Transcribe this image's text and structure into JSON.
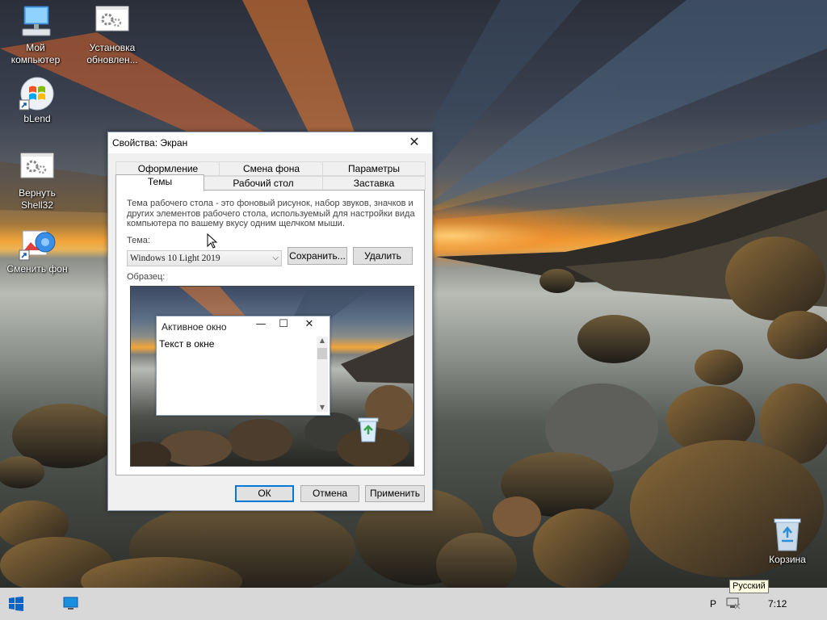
{
  "desktop": {
    "icons": [
      {
        "label": "Мой\nкомпьютер",
        "icon": "computer-icon"
      },
      {
        "label": "Установка\nобновлен...",
        "icon": "gear-icon"
      },
      {
        "label": "bLend",
        "icon": "windows-logo-icon"
      },
      {
        "label": "Вернуть\nShell32",
        "icon": "gear-icon"
      },
      {
        "label": "Сменить фон",
        "icon": "change-wallpaper-icon"
      },
      {
        "label": "Корзина",
        "icon": "recycle-bin-icon"
      }
    ]
  },
  "dialog": {
    "title": "Свойства: Экран",
    "tabs_row1": [
      "Оформление",
      "Смена фона",
      "Параметры"
    ],
    "tabs_row2": [
      "Темы",
      "Рабочий стол",
      "Заставка"
    ],
    "active_tab": "Темы",
    "description": "Тема рабочего стола - это фоновый рисунок, набор звуков, значков и других элементов рабочего стола, используемый для настройки вида компьютера по вашему вкусу одним щелчком мыши.",
    "theme_label": "Тема:",
    "theme_value": "Windows 10 Light 2019",
    "save_label": "Сохранить...",
    "delete_label": "Удалить",
    "sample_label": "Образец:",
    "preview_window": {
      "title": "Активное окно",
      "text": "Текст в окне"
    },
    "ok_label": "ОК",
    "cancel_label": "Отмена",
    "apply_label": "Применить"
  },
  "taskbar": {
    "lang_short": "Р",
    "lang_tooltip": "Русский",
    "clock": "7:12"
  },
  "colors": {
    "accent": "#0078d7",
    "taskbar": "#d8d8d8",
    "dialog_bg": "#f0f0f0"
  }
}
